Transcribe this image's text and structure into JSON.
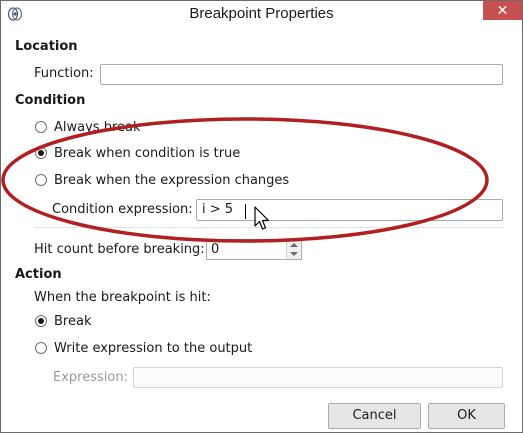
{
  "window": {
    "title": "Breakpoint Properties",
    "close_glyph": "✕"
  },
  "location": {
    "heading": "Location",
    "function_label": "Function:",
    "function_value": ""
  },
  "condition": {
    "heading": "Condition",
    "options": [
      {
        "label": "Always break",
        "checked": false
      },
      {
        "label": "Break when condition is true",
        "checked": true
      },
      {
        "label": "Break when the expression changes",
        "checked": false
      }
    ],
    "expression_label": "Condition expression:",
    "expression_value": "i > 5",
    "hit_count_label": "Hit count before breaking:",
    "hit_count_value": "0"
  },
  "action": {
    "heading": "Action",
    "when_label": "When the breakpoint is hit:",
    "options": [
      {
        "label": "Break",
        "checked": true
      },
      {
        "label": "Write expression to the output",
        "checked": false
      }
    ],
    "expression_label": "Expression:",
    "expression_value": ""
  },
  "buttons": {
    "cancel": "Cancel",
    "ok": "OK"
  },
  "colors": {
    "annotation_ellipse": "#b02020",
    "close_button": "#c75050"
  },
  "icons": [
    "app-icon",
    "close-icon",
    "mouse-cursor-icon"
  ]
}
